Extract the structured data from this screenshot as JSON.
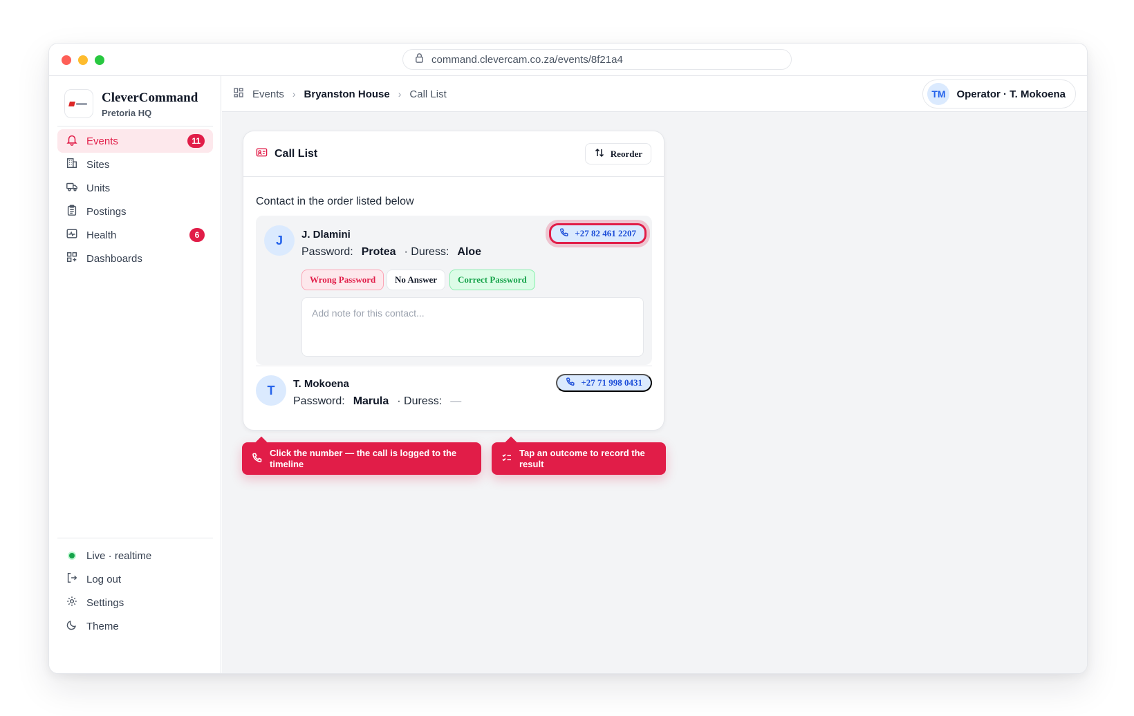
{
  "browser": {
    "url": "command.clevercam.co.za/events/8f21a4",
    "lock_icon": "lock-icon"
  },
  "sidebar": {
    "brand_name": "CleverCommand",
    "brand_sub": "Pretoria HQ",
    "nav": [
      {
        "label": "Events",
        "icon": "bell-icon",
        "badge": "11",
        "active": true
      },
      {
        "label": "Sites",
        "icon": "building-icon"
      },
      {
        "label": "Units",
        "icon": "truck-icon"
      },
      {
        "label": "Postings",
        "icon": "clipboard-icon"
      },
      {
        "label": "Health",
        "icon": "activity-icon",
        "badge": "6"
      },
      {
        "label": "Dashboards",
        "icon": "grid-icon"
      }
    ],
    "footer": {
      "live": "Live · realtime",
      "logout": "Log out",
      "settings": "Settings",
      "theme": "Theme"
    }
  },
  "topbar": {
    "crumbs": [
      "Events",
      "Bryanston House",
      "Call List"
    ],
    "operator_initials": "TM",
    "operator_name": "Operator · T. Mokoena"
  },
  "call_list": {
    "title": "Call List",
    "reorder_label": "Reorder",
    "instruction": "Contact in the order listed below",
    "contacts": [
      {
        "initial": "J",
        "name": "J. Dlamini",
        "password_label": "Password:",
        "password": "Protea",
        "duress_label": "· Duress:",
        "duress": "Aloe",
        "phone": "+27 82 461 2207",
        "outcomes": [
          "Wrong Password",
          "No Answer",
          "Correct Password"
        ],
        "note_placeholder": "Add note for this contact..."
      },
      {
        "initial": "T",
        "name": "T. Mokoena",
        "password_label": "Password:",
        "password": "Marula",
        "duress_label": "· Duress:",
        "duress": "—",
        "phone": "+27 71 998 0431"
      }
    ]
  },
  "tips": [
    {
      "text": "Click the number — the call is logged to the timeline",
      "icon": "phone-icon"
    },
    {
      "text": "Tap an outcome to record the result",
      "icon": "checklist-icon"
    }
  ],
  "colors": {
    "accent": "#e11d48",
    "accent_soft": "#fde8ec",
    "blue": "#2563eb",
    "success": "#16a34a"
  }
}
